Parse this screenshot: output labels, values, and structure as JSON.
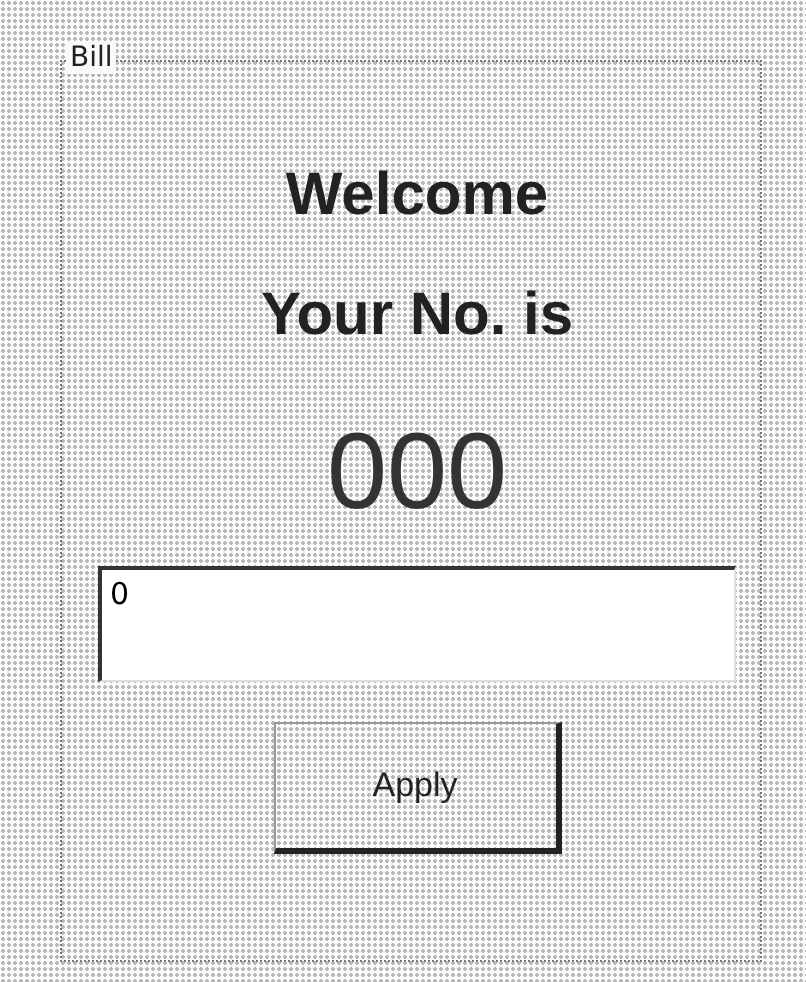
{
  "group": {
    "title": "Bill"
  },
  "welcome": "Welcome",
  "prompt": "Your No. is",
  "number": "000",
  "input": {
    "value": "0"
  },
  "buttons": [
    {
      "label": "Apply"
    }
  ]
}
